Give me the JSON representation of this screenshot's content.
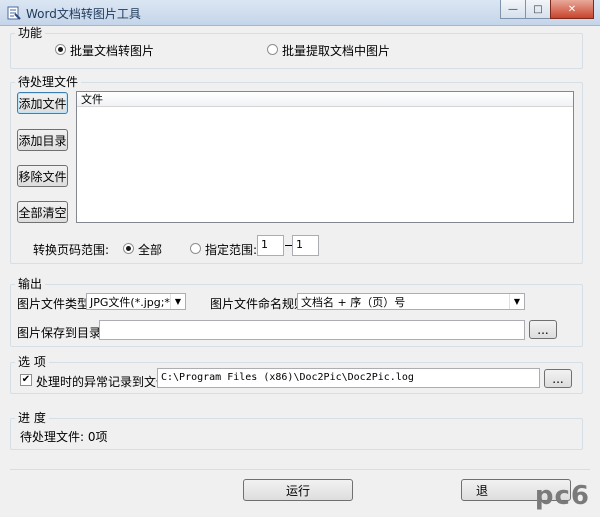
{
  "window": {
    "title": "Word文档转图片工具",
    "min_glyph": "—",
    "max_glyph": "□",
    "close_glyph": "✕"
  },
  "function_group": {
    "label": "功能",
    "option_batch_convert": "批量文档转图片",
    "option_batch_extract": "批量提取文档中图片",
    "selected": "批量文档转图片"
  },
  "pending_group": {
    "label": "待处理文件",
    "buttons": {
      "add_file": "添加文件",
      "add_dir": "添加目录",
      "remove_file": "移除文件",
      "clear_all": "全部清空"
    },
    "list_header": "文件",
    "page_range_label": "转换页码范围:",
    "range_all": "全部",
    "range_specified": "指定范围:",
    "range_selected": "全部",
    "range_from": "1",
    "range_to": "1"
  },
  "output_group": {
    "label": "输出",
    "image_type_label": "图片文件类型:",
    "image_type_value": "JPG文件(*.jpg;*.",
    "naming_label": "图片文件命名规则:",
    "naming_value": "文档名 + 序（页）号",
    "save_dir_label": "图片保存到目录:",
    "save_dir_value": "",
    "browse_label": "..."
  },
  "options_group": {
    "label": "选  项",
    "log_checkbox_label": "处理时的异常记录到文件:",
    "log_checked": true,
    "log_path": "C:\\Program Files (x86)\\Doc2Pic\\Doc2Pic.log",
    "browse_label": "..."
  },
  "progress_group": {
    "label": "进  度",
    "status": "待处理文件: 0项"
  },
  "footer": {
    "run_label": "运行",
    "exit_label": "退"
  },
  "watermark": "pc6"
}
